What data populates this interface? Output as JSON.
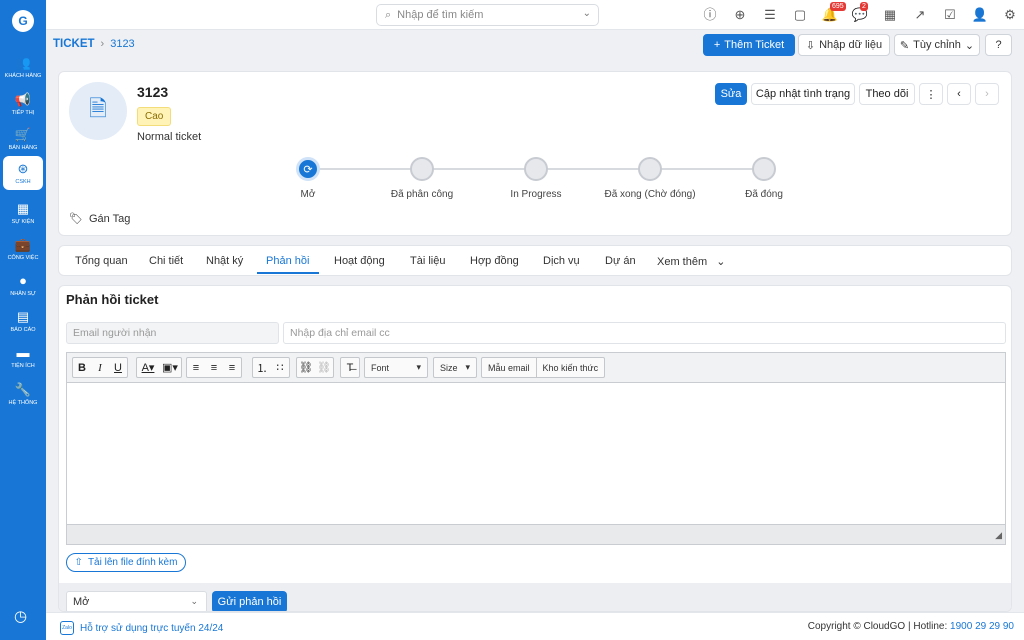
{
  "sidebar": {
    "logo": "G",
    "items": [
      {
        "label": "KHÁCH HÀNG",
        "icon": "customers-icon",
        "glyph": "👥"
      },
      {
        "label": "TIẾP THỊ",
        "icon": "megaphone-icon",
        "glyph": "📢"
      },
      {
        "label": "BÁN HÀNG",
        "icon": "cart-icon",
        "glyph": "🛒"
      },
      {
        "label": "CSKH",
        "icon": "support-icon",
        "glyph": "⊛"
      },
      {
        "label": "SỰ KIỆN",
        "icon": "calendar-icon",
        "glyph": "▦"
      },
      {
        "label": "CÔNG VIỆC",
        "icon": "briefcase-icon",
        "glyph": "💼"
      },
      {
        "label": "NHÂN SỰ",
        "icon": "person-icon",
        "glyph": "●"
      },
      {
        "label": "BÁO CÁO",
        "icon": "report-icon",
        "glyph": "▤"
      },
      {
        "label": "TIỆN ÍCH",
        "icon": "utilities-icon",
        "glyph": "▬"
      },
      {
        "label": "HỆ THỐNG",
        "icon": "wrench-icon",
        "glyph": "🔧"
      }
    ],
    "active_index": 3
  },
  "topbar": {
    "search_placeholder": "Nhập để tìm kiếm",
    "notification_count": "695",
    "chat_count": "2"
  },
  "breadcrumb": {
    "root": "TICKET",
    "current": "3123"
  },
  "actions": {
    "add_ticket": "Thêm Ticket",
    "import": "Nhập dữ liệu",
    "customize": "Tùy chỉnh"
  },
  "ticket": {
    "number": "3123",
    "priority": "Cao",
    "type": "Normal ticket",
    "edit": "Sửa",
    "update_status": "Cập nhật tình trạng",
    "follow": "Theo dõi",
    "tag": "Gán Tag"
  },
  "steps": [
    "Mở",
    "Đã phân công",
    "In Progress",
    "Đã xong (Chờ đóng)",
    "Đã đóng"
  ],
  "tabs": [
    "Tổng quan",
    "Chi tiết",
    "Nhật ký",
    "Phản hồi",
    "Hoạt động",
    "Tài liệu",
    "Hợp đồng",
    "Dịch vụ",
    "Dự án",
    "Xem thêm"
  ],
  "active_tab": 3,
  "reply": {
    "title": "Phản hồi ticket",
    "recipient_placeholder": "Email người nhận",
    "cc_placeholder": "Nhập địa chỉ email cc",
    "font_label": "Font",
    "size_label": "Size",
    "template_label": "Mẫu email",
    "knowledge_label": "Kho kiến thức",
    "upload_label": "Tải lên file đính kèm",
    "status_value": "Mở",
    "send_label": "Gửi phản hồi"
  },
  "footer": {
    "support": "Hỗ trợ sử dụng trực tuyến 24/24",
    "zalo": "Zalo",
    "copyright": "Copyright © CloudGO",
    "hotline_label": "Hotline:",
    "hotline": "1900 29 29 90"
  }
}
